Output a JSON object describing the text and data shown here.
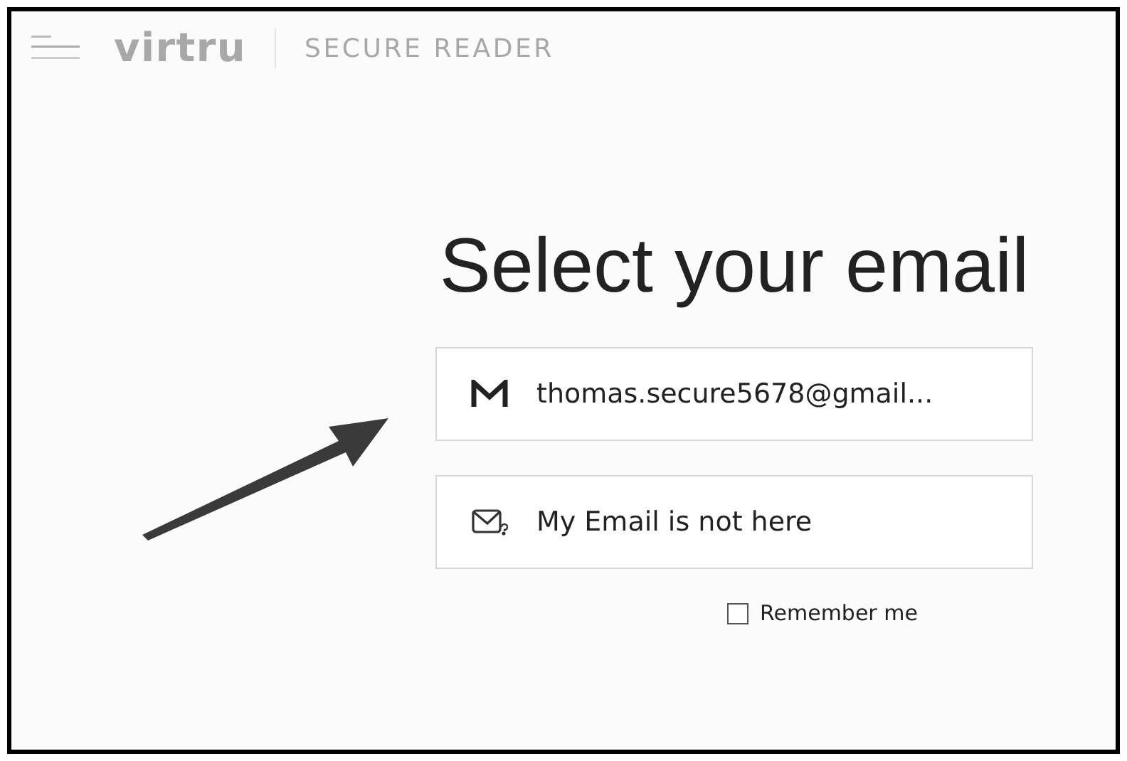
{
  "header": {
    "logo": "virtru",
    "product": "SECURE READER"
  },
  "title": "Select your email",
  "options": [
    {
      "kind": "gmail",
      "label": "thomas.secure5678@gmail..."
    },
    {
      "kind": "other",
      "label": "My Email is not here"
    }
  ],
  "remember": {
    "label": "Remember me",
    "checked": false
  }
}
